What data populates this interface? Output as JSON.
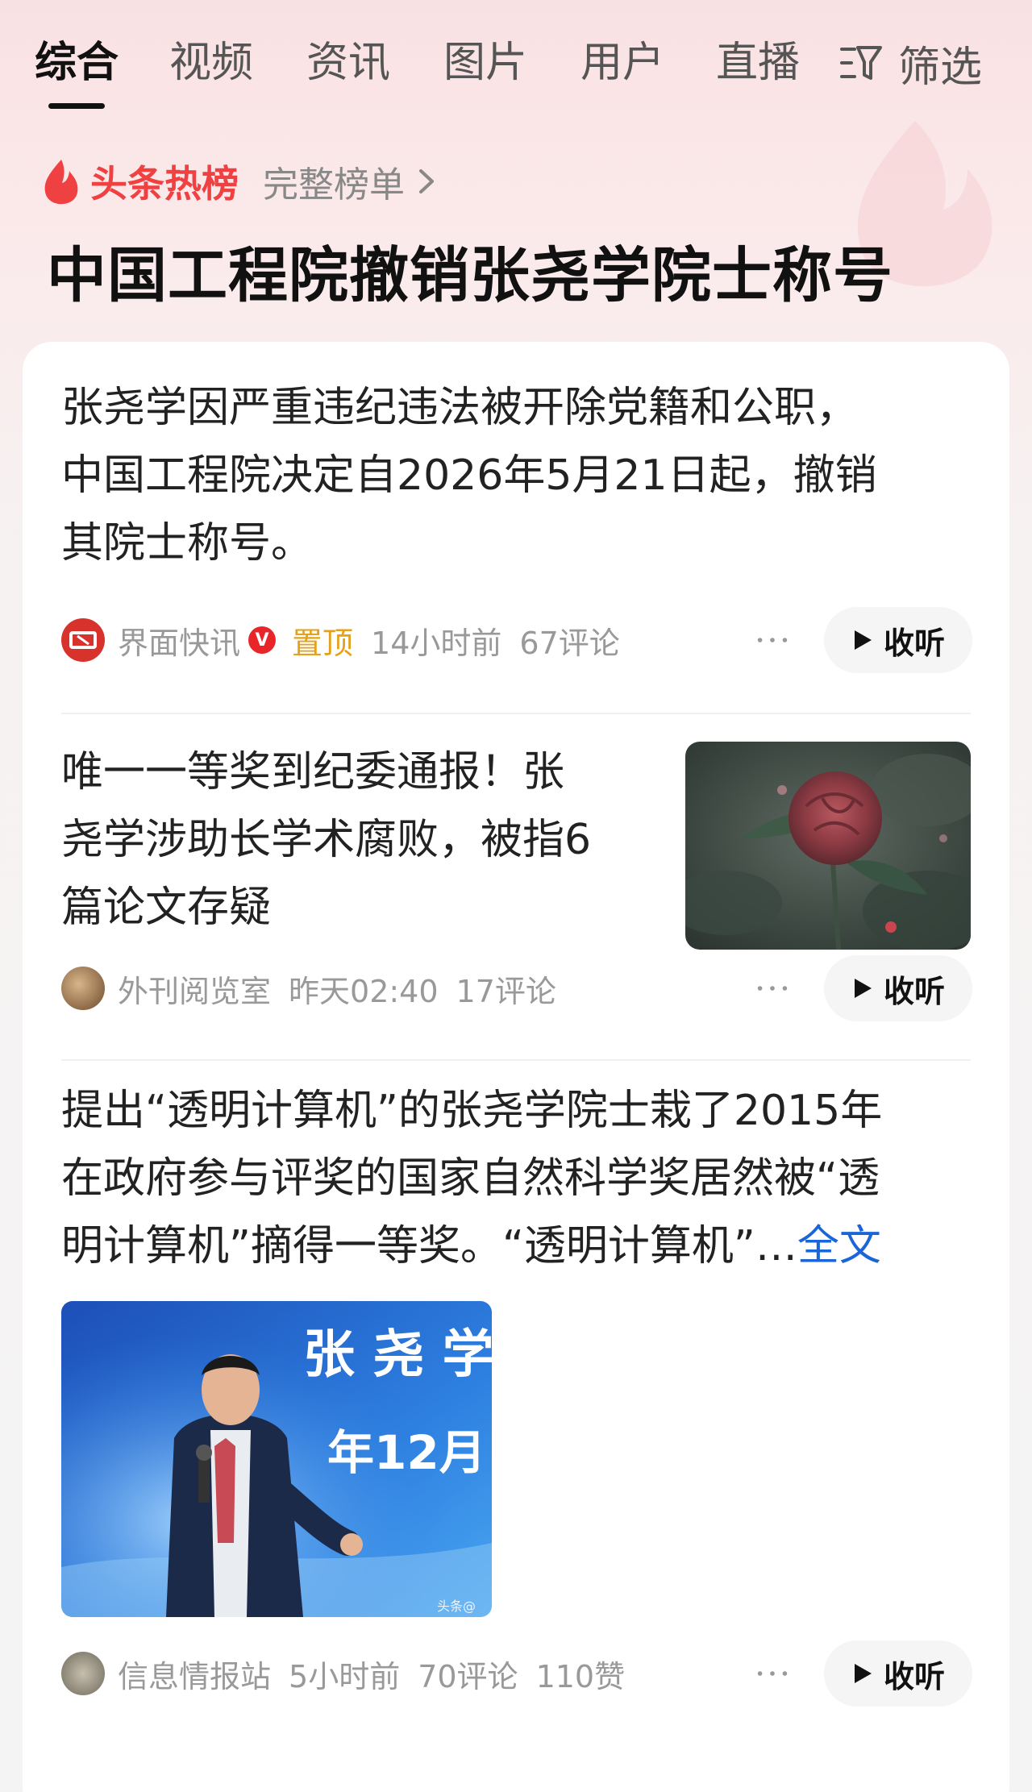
{
  "tabs": [
    {
      "label": "综合",
      "active": true
    },
    {
      "label": "视频"
    },
    {
      "label": "资讯"
    },
    {
      "label": "图片"
    },
    {
      "label": "用户"
    },
    {
      "label": "直播"
    }
  ],
  "filter": {
    "label": "筛选",
    "icon": "filter-icon"
  },
  "hot": {
    "title": "头条热榜",
    "full_list": "完整榜单",
    "headline": "中国工程院撤销张尧学院士称号"
  },
  "articles": [
    {
      "lines": [
        "张尧学因严重违纪违法被开除党籍和公职，",
        "中国工程院决定自2026年5月21日起，撤销",
        "其院士称号。"
      ],
      "source": "界面快讯",
      "verified": "V",
      "pinned": "置顶",
      "time": "14小时前",
      "comments": "67评论",
      "listen": "收听"
    },
    {
      "lines": [
        "唯一一等奖到纪委通报！张",
        "尧学涉助长学术腐败，被指6",
        "篇论文存疑"
      ],
      "source": "外刊阅览室",
      "time": "昨天02:40",
      "comments": "17评论",
      "listen": "收听",
      "image": "rose-photo"
    },
    {
      "lines": [
        "提出“透明计算机”的张尧学院士栽了2015年",
        "在政府参与评奖的国家自然科学奖居然被“透",
        "明计算机”摘得一等奖。“透明计算机”…"
      ],
      "more": "全文",
      "image_text": [
        "张 尧 学",
        "年12月"
      ],
      "watermark": "头条@",
      "source": "信息情报站",
      "time": "5小时前",
      "comments": "70评论",
      "likes": "110赞",
      "listen": "收听"
    }
  ],
  "colors": {
    "accent_red": "#f04142",
    "pin": "#e3a21a",
    "link": "#1a66d9"
  }
}
